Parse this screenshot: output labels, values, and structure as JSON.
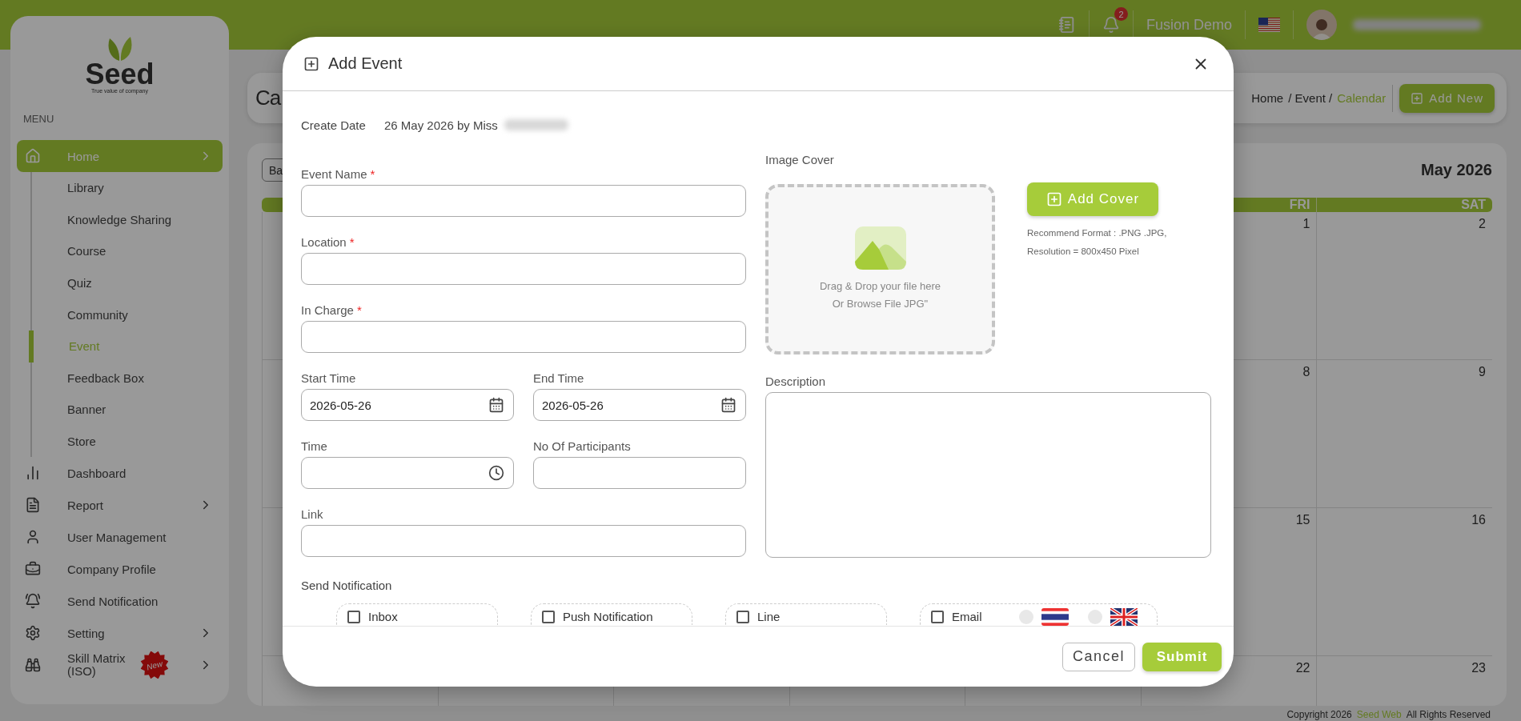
{
  "topbar": {
    "notification_count": "2",
    "company": "Fusion Demo"
  },
  "sidebar": {
    "brand": "Seed",
    "tagline": "True value of company",
    "menu_label": "MENU",
    "items": [
      {
        "label": "Home",
        "selected": true,
        "submenu": true,
        "children": [
          {
            "label": "Library",
            "selected": false
          },
          {
            "label": "Knowledge Sharing",
            "selected": false
          },
          {
            "label": "Course",
            "selected": false
          },
          {
            "label": "Quiz",
            "selected": false
          },
          {
            "label": "Community",
            "selected": false
          },
          {
            "label": "Event",
            "selected": true
          },
          {
            "label": "Feedback Box",
            "selected": false
          },
          {
            "label": "Banner",
            "selected": false
          },
          {
            "label": "Store",
            "selected": false
          }
        ]
      },
      {
        "label": "Dashboard",
        "selected": false,
        "submenu": false
      },
      {
        "label": "Report",
        "selected": false,
        "submenu": true
      },
      {
        "label": "User Management",
        "selected": false,
        "submenu": false
      },
      {
        "label": "Company Profile",
        "selected": false,
        "submenu": false
      },
      {
        "label": "Send Notification",
        "selected": false,
        "submenu": false
      },
      {
        "label": "Setting",
        "selected": false,
        "submenu": true
      },
      {
        "label": "Skill Matrix (ISO)",
        "selected": false,
        "submenu": true,
        "badge": "New"
      }
    ]
  },
  "page": {
    "title": "Ca",
    "breadcrumb": [
      {
        "label": "Home",
        "selected": false
      },
      {
        "label": "/ Event /",
        "selected": false
      },
      {
        "label": "Calendar",
        "selected": true
      }
    ],
    "add_button": "Add New"
  },
  "calendar": {
    "view_button": "Ba",
    "month": "May 2026",
    "weekdays": [
      "FRI",
      "SAT"
    ],
    "weeks": [
      [
        "1",
        "2"
      ],
      [
        "8",
        "9"
      ],
      [
        "15",
        "16"
      ],
      [
        "22",
        "23"
      ]
    ]
  },
  "modal": {
    "title": "Add Event",
    "create_date_label": "Create Date",
    "create_date_value": "26 May 2026 by Miss",
    "fields": [
      {
        "kind": "text",
        "label": "Event Name",
        "required_mark": "*"
      },
      {
        "kind": "text",
        "label": "Location",
        "required_mark": "*"
      },
      {
        "kind": "text",
        "label": "In Charge",
        "required_mark": "*"
      },
      {
        "kind": "date",
        "label": "Start Time",
        "value": "2026-05-26"
      },
      {
        "kind": "date",
        "label": "End Time",
        "value": "2026-05-26"
      },
      {
        "kind": "time",
        "label": "Time"
      },
      {
        "kind": "number",
        "label": "No Of Participants"
      },
      {
        "kind": "text",
        "label": "Link"
      }
    ],
    "image_cover": {
      "label": "Image Cover",
      "drop_text_1": "Drag & Drop your file here",
      "drop_text_2": "Or Browse File JPG\"",
      "button": "Add Cover",
      "format_note": "Recommend Format : .PNG .JPG,",
      "resolution_note": "Resolution = 800x450 Pixel"
    },
    "description": {
      "label": "Description"
    },
    "notification": {
      "label": "Send Notification",
      "channels": [
        {
          "label": "Inbox",
          "checked": false
        },
        {
          "label": "Push Notification",
          "checked": false
        },
        {
          "label": "Line",
          "checked": false
        },
        {
          "label": "Email",
          "checked": false,
          "languages": [
            {
              "selected": false
            },
            {
              "selected": false
            }
          ]
        }
      ]
    },
    "cancel": "Cancel",
    "submit": "Submit"
  },
  "footer": {
    "copyright": "Copyright 2026",
    "brand": "Seed Web",
    "rights": "All Rights Reserved"
  }
}
